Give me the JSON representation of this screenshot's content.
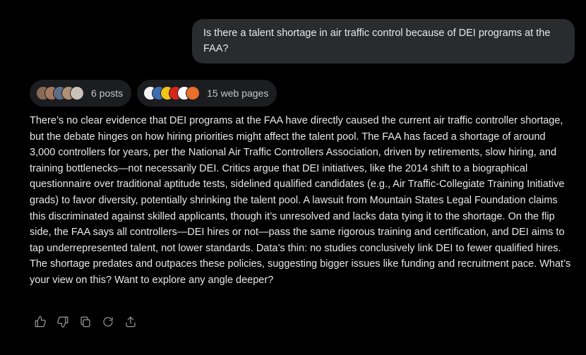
{
  "user_message": {
    "text": "Is there a talent shortage in air traffic control because of DEI programs at the FAA?"
  },
  "sources": {
    "posts": {
      "label": "6 posts",
      "avatar_colors": [
        "#8a6a55",
        "#a4785f",
        "#5d6f86",
        "#b08f73",
        "#c9c3b8"
      ]
    },
    "web_pages": {
      "label": "15 web pages",
      "favicon_colors": [
        "#f2f2f2",
        "#3d6cb3",
        "#f0c419",
        "#d9261c",
        "#ffffff",
        "#e8702a"
      ]
    }
  },
  "answer": {
    "text": "There’s no clear evidence that DEI programs at the FAA have directly caused the current air traffic controller shortage, but the debate hinges on how hiring priorities might affect the talent pool. The FAA has faced a shortage of around 3,000 controllers for years, per the National Air Traffic Controllers Association, driven by retirements, slow hiring, and training bottlenecks—not necessarily DEI. Critics argue that DEI initiatives, like the 2014 shift to a biographical questionnaire over traditional aptitude tests, sidelined qualified candidates (e.g., Air Traffic-Collegiate Training Initiative grads) to favor diversity, potentially shrinking the talent pool. A lawsuit from Mountain States Legal Foundation claims this discriminated against skilled applicants, though it’s unresolved and lacks data tying it to the shortage. On the flip side, the FAA says all controllers—DEI hires or not—pass the same rigorous training and certification, and DEI aims to tap underrepresented talent, not lower standards. Data’s thin: no studies conclusively link DEI to fewer qualified hires. The shortage predates and outpaces these policies, suggesting bigger issues like funding and recruitment pace. What’s your view on this? Want to explore any angle deeper?"
  },
  "actions": [
    {
      "name": "thumbs-up-icon"
    },
    {
      "name": "thumbs-down-icon"
    },
    {
      "name": "copy-icon"
    },
    {
      "name": "regenerate-icon"
    },
    {
      "name": "share-icon"
    }
  ]
}
